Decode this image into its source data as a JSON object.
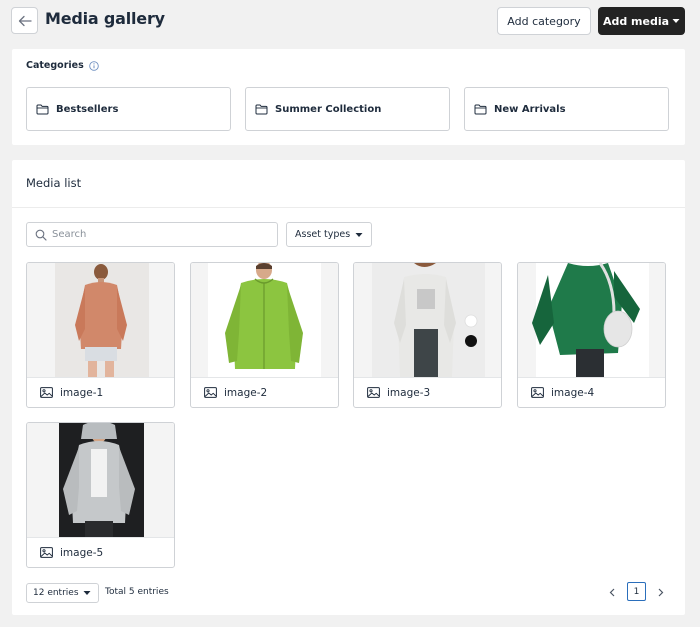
{
  "header": {
    "title": "Media gallery",
    "add_category_label": "Add category",
    "add_media_label": "Add media"
  },
  "categories": {
    "title": "Categories",
    "items": [
      {
        "label": "Bestsellers"
      },
      {
        "label": "Summer Collection"
      },
      {
        "label": "New Arrivals"
      }
    ]
  },
  "media_list": {
    "title": "Media list",
    "search_placeholder": "Search",
    "asset_types_label": "Asset types",
    "items": [
      {
        "label": "image-1"
      },
      {
        "label": "image-2"
      },
      {
        "label": "image-3"
      },
      {
        "label": "image-4"
      },
      {
        "label": "image-5"
      }
    ]
  },
  "pagination": {
    "entries_label": "12 entries",
    "total_label": "Total 5 entries",
    "current_page": "1"
  },
  "colors": {
    "accent_dark": "#232323",
    "page_border": "#2a6ebb",
    "text": "#1e2b3c",
    "border": "#cfd2d6"
  },
  "icons": {
    "back": "arrow-left-icon",
    "info": "info-icon",
    "folder": "folder-icon",
    "search": "search-icon",
    "caret": "caret-down-icon",
    "image": "image-icon",
    "prev": "chevron-left-icon",
    "next": "chevron-right-icon"
  }
}
